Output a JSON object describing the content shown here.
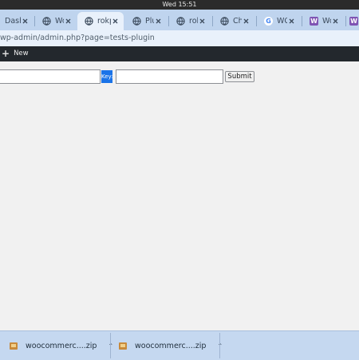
{
  "system_bar": {
    "clock": "Wed 15:51"
  },
  "tabs": [
    {
      "label": "Dash",
      "icon": "wordpress-icon"
    },
    {
      "label": "Woo",
      "icon": "globe-icon"
    },
    {
      "label": "rokp",
      "icon": "globe-icon",
      "active": true
    },
    {
      "label": "Plug",
      "icon": "globe-icon"
    },
    {
      "label": "rokp",
      "icon": "globe-icon"
    },
    {
      "label": "Chec",
      "icon": "globe-icon"
    },
    {
      "label": "WC_",
      "icon": "google-icon",
      "icon_text": "G"
    },
    {
      "label": "Woo",
      "icon": "woo-icon",
      "icon_text": "W"
    },
    {
      "label": "",
      "icon": "woo-icon",
      "icon_text": "W"
    }
  ],
  "address_bar": {
    "url": "wp-admin/admin.php?page=tests-plugin"
  },
  "admin_bar": {
    "new_label": "New",
    "new_icon": "plus-icon"
  },
  "form": {
    "first_value": "",
    "key_label": "Key:",
    "key_value": "",
    "submit_label": "Submit"
  },
  "downloads": [
    {
      "filename": "woocommerc....zip",
      "icon": "archive-icon"
    },
    {
      "filename": "woocommerc....zip",
      "icon": "archive-icon"
    }
  ],
  "colors": {
    "tab_strip": "#bfd4ee",
    "admin_bar": "#23282d",
    "key_highlight": "#1a73e8",
    "woo_purple": "#7f54b3"
  }
}
